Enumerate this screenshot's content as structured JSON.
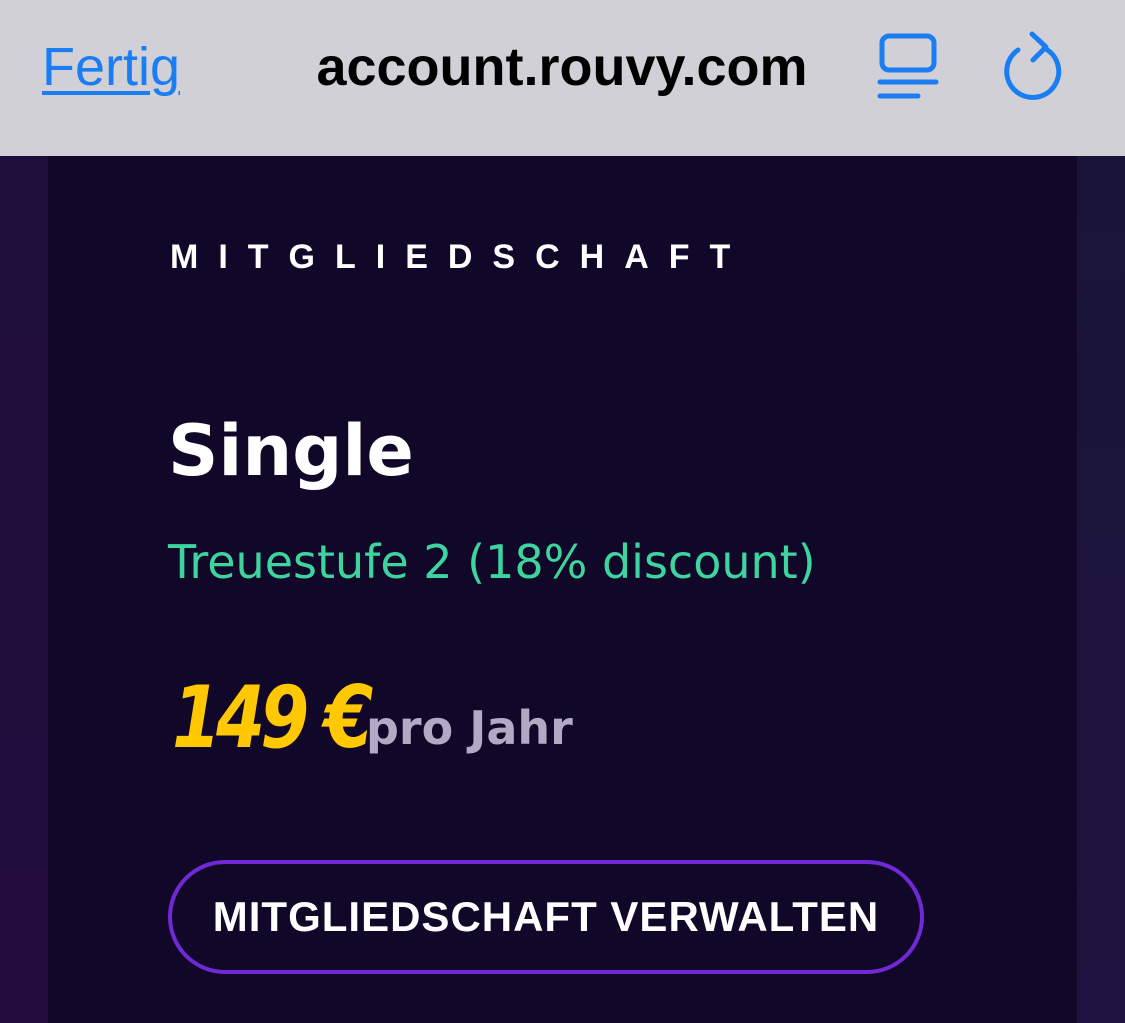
{
  "browser": {
    "done_label": "Fertig",
    "url": "account.rouvy.com",
    "reader_icon": "reader-mode-icon",
    "reload_icon": "reload-icon",
    "accent_color": "#1a7df2"
  },
  "membership": {
    "section_label": "MITGLIEDSCHAFT",
    "plan_name": "Single",
    "loyalty_text": "Treuestufe 2 (18% discount)",
    "price": "149 €",
    "period": "pro Jahr",
    "manage_button_label": "MITGLIEDSCHAFT VERWALTEN",
    "colors": {
      "card_background": "#110728",
      "loyalty": "#3dd49f",
      "price": "#ffc800",
      "button_border": "#7129d6"
    }
  }
}
